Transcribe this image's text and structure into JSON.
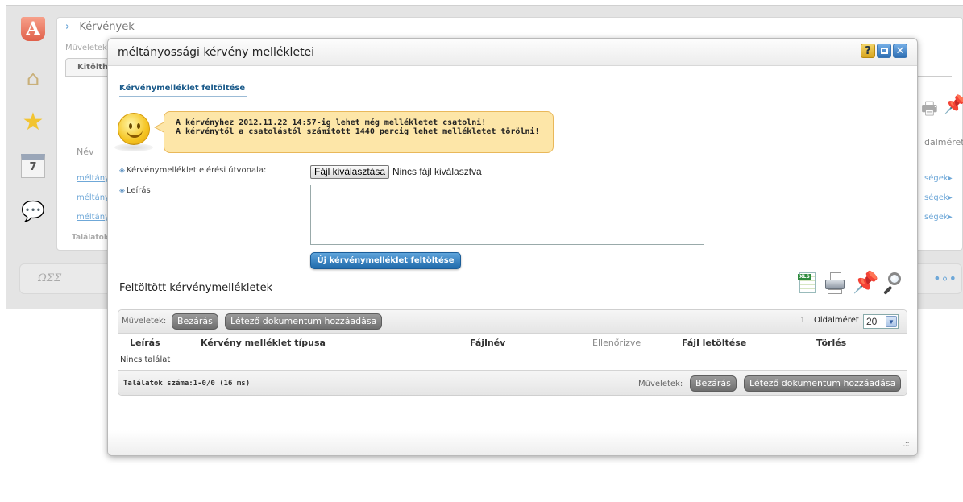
{
  "background": {
    "title": "Kérvények",
    "muveletek": "Műveletek:",
    "tab": "Kitölthe",
    "col_nev": "Név",
    "links": [
      "méltányo",
      "méltányo",
      "méltányo"
    ],
    "found": "Találatok s",
    "oldalmeret": "dalméret",
    "right_links": [
      "ségek▸",
      "ségek▸",
      "ségek▸"
    ],
    "logo": "ΩΣΣ",
    "calendar_day": "7",
    "app_icon_letter": "A",
    "icons": [
      "app-logo-icon",
      "home-icon",
      "star-icon",
      "calendar-icon",
      "chat-icon"
    ]
  },
  "modal": {
    "title": "méltányossági kérvény mellékletei",
    "header_buttons": {
      "help": "?",
      "maximize": "",
      "close": "✕"
    },
    "upload_heading": "Kérvénymelléklet feltöltése",
    "notice_line1": "A kérvényhez 2012.11.22 14:57-ig lehet még mellékletet csatolni!",
    "notice_line2": "A kérvénytől a csatolástól számított 1440 percig lehet mellékletet törölni!",
    "path_label": "Kérvénymelléklet elérési útvonala:",
    "file_button": "Fájl kiválasztása",
    "file_none": "Nincs fájl kiválasztva",
    "description_label": "Leírás",
    "description_value": "",
    "upload_button": "Új kérvénymelléklet feltöltése",
    "uploaded_title": "Feltöltött kérvénymellékletek",
    "tool_icons": [
      "xls-export-icon",
      "print-icon",
      "pin-icon",
      "search-icon"
    ],
    "xls_tag": "XLS",
    "grid": {
      "muveletek": "Műveletek:",
      "close_button": "Bezárás",
      "add_button": "Létező dokumentum hozzáadása",
      "page_number": "1",
      "page_size_label": "Oldalméret",
      "page_size_value": "20",
      "columns": [
        "Leírás",
        "Kérvény melléklet típusa",
        "Fájlnév",
        "Ellenőrizve",
        "Fájl letöltése",
        "Törlés"
      ],
      "no_result": "Nincs találat",
      "found": "Találatok száma:1-0/0 (16 ms)"
    },
    "resize_glyph": ".::"
  },
  "colors": {
    "accent_blue": "#2f6fb3",
    "notice_bg": "#fde6a8",
    "notice_border": "#e9b85a",
    "gray_button": "#7f7f7f"
  }
}
